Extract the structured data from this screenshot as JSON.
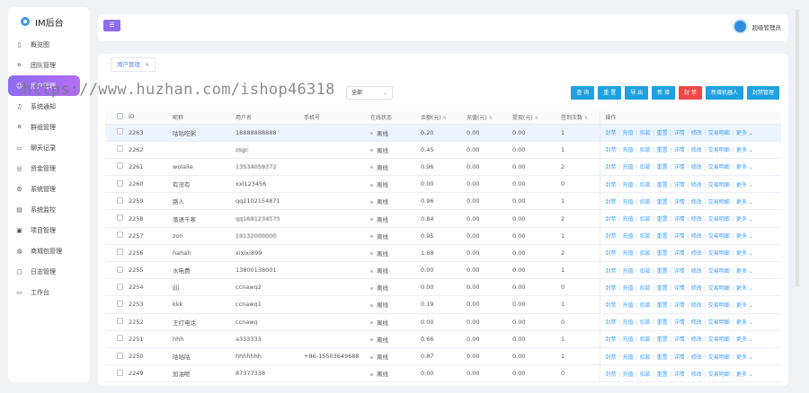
{
  "app_title": "IM后台",
  "sidebar": {
    "items": [
      {
        "label": "概览图",
        "icon": "doc-icon",
        "active": false
      },
      {
        "label": "团队管理",
        "icon": "team-icon",
        "active": false
      },
      {
        "label": "用户管理",
        "icon": "user-icon",
        "active": true
      },
      {
        "label": "系统通知",
        "icon": "bell-icon",
        "active": false
      },
      {
        "label": "群组管理",
        "icon": "group-icon",
        "active": false
      },
      {
        "label": "聊天记录",
        "icon": "chat-icon",
        "active": false
      },
      {
        "label": "资金管理",
        "icon": "money-icon",
        "active": false
      },
      {
        "label": "系统管理",
        "icon": "gear-icon",
        "active": false
      },
      {
        "label": "系统监控",
        "icon": "monitor-icon",
        "active": false
      },
      {
        "label": "项目管理",
        "icon": "project-icon",
        "active": false
      },
      {
        "label": "商城包管理",
        "icon": "shop-icon",
        "active": false
      },
      {
        "label": "日志管理",
        "icon": "log-icon",
        "active": false
      },
      {
        "label": "工作台",
        "icon": "desktop-icon",
        "active": false
      }
    ]
  },
  "header": {
    "toggle_label": "☰",
    "admin_name": "超级管理员"
  },
  "tabs": [
    {
      "label": "用户管理",
      "close": "×"
    }
  ],
  "filter": {
    "status_select": "全部"
  },
  "toolbar": [
    "查 询",
    "重 置",
    "导 出",
    "新 增",
    "封 禁",
    "新增机器人",
    "封禁管理"
  ],
  "watermark": "https://www.huzhan.com/ishop46318",
  "table": {
    "headers": [
      "ID",
      "昵称",
      "用户名",
      "手机号",
      "在线状态",
      "余额(元)",
      "充值(元)",
      "提现(元)",
      "签到次数",
      "操作"
    ],
    "rows": [
      {
        "id": "2263",
        "nick": "咕咕吃粥",
        "user": "18888888888",
        "phone": "",
        "status": "离线",
        "bal": "0.20",
        "rec": "0.00",
        "wd": "0.00",
        "sign": "1"
      },
      {
        "id": "2262",
        "nick": "",
        "user": "zsgc",
        "phone": "",
        "status": "离线",
        "bal": "0.45",
        "rec": "0.00",
        "wd": "0.00",
        "sign": "1"
      },
      {
        "id": "2261",
        "nick": "wolalle",
        "user": "13534059372",
        "phone": "",
        "status": "离线",
        "bal": "0.96",
        "rec": "0.00",
        "wd": "0.00",
        "sign": "2"
      },
      {
        "id": "2260",
        "nick": "有没有",
        "user": "xxl123456",
        "phone": "",
        "status": "离线",
        "bal": "0.00",
        "rec": "0.00",
        "wd": "0.00",
        "sign": "0"
      },
      {
        "id": "2259",
        "nick": "路人",
        "user": "qq2102154871",
        "phone": "",
        "status": "离线",
        "bal": "0.96",
        "rec": "0.00",
        "wd": "0.00",
        "sign": "1"
      },
      {
        "id": "2258",
        "nick": "落语千寒",
        "user": "qq1691234575",
        "phone": "",
        "status": "离线",
        "bal": "0.84",
        "rec": "0.00",
        "wd": "0.00",
        "sign": "2"
      },
      {
        "id": "2257",
        "nick": "zon",
        "user": "19132000000",
        "phone": "",
        "status": "离线",
        "bal": "0.95",
        "rec": "0.00",
        "wd": "0.00",
        "sign": "1"
      },
      {
        "id": "2256",
        "nick": "hahah",
        "user": "xixixi899",
        "phone": "",
        "status": "离线",
        "bal": "1.68",
        "rec": "0.00",
        "wd": "0.00",
        "sign": "2"
      },
      {
        "id": "2255",
        "nick": "水电费",
        "user": "13800138001",
        "phone": "",
        "status": "离线",
        "bal": "0.00",
        "rec": "0.00",
        "wd": "0.00",
        "sign": "1"
      },
      {
        "id": "2254",
        "nick": "jjjj",
        "user": "ccnawq2",
        "phone": "",
        "status": "离线",
        "bal": "0.00",
        "rec": "0.00",
        "wd": "0.00",
        "sign": "0"
      },
      {
        "id": "2253",
        "nick": "kkk",
        "user": "ccnawq1",
        "phone": "",
        "status": "离线",
        "bal": "0.19",
        "rec": "0.00",
        "wd": "0.00",
        "sign": "1"
      },
      {
        "id": "2252",
        "nick": "王打电话",
        "user": "ccnawq",
        "phone": "",
        "status": "离线",
        "bal": "0.00",
        "rec": "0.00",
        "wd": "0.00",
        "sign": "0"
      },
      {
        "id": "2251",
        "nick": "hhh",
        "user": "a333333",
        "phone": "",
        "status": "离线",
        "bal": "0.66",
        "rec": "0.00",
        "wd": "0.00",
        "sign": "1"
      },
      {
        "id": "2250",
        "nick": "咕咕咕",
        "user": "hhhhhhh",
        "phone": "+86-15503649688",
        "status": "离线",
        "bal": "0.87",
        "rec": "0.00",
        "wd": "0.00",
        "sign": "1"
      },
      {
        "id": "2249",
        "nick": "加油呢",
        "user": "87377338",
        "phone": "",
        "status": "离线",
        "bal": "0.00",
        "rec": "0.00",
        "wd": "0.00",
        "sign": "0"
      }
    ],
    "actions": [
      "封禁",
      "充值",
      "扣款",
      "重置",
      "详情",
      "修改",
      "交易明细",
      "更多"
    ]
  }
}
